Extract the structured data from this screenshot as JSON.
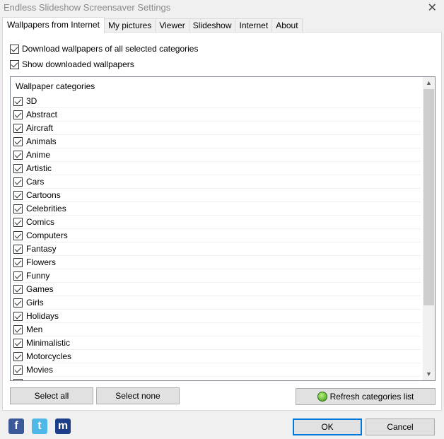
{
  "window": {
    "title": "Endless Slideshow Screensaver Settings",
    "close": "✕"
  },
  "tabs": [
    {
      "label": "Wallpapers from Internet",
      "active": true
    },
    {
      "label": "My pictures"
    },
    {
      "label": "Viewer"
    },
    {
      "label": "Slideshow"
    },
    {
      "label": "Internet"
    },
    {
      "label": "About"
    }
  ],
  "options": {
    "download_all": {
      "label": "Download wallpapers of all selected categories",
      "checked": true
    },
    "show_downloaded": {
      "label": "Show downloaded wallpapers",
      "checked": true
    }
  },
  "categories": {
    "header": "Wallpaper categories",
    "items": [
      "3D",
      "Abstract",
      "Aircraft",
      "Animals",
      "Anime",
      "Artistic",
      "Cars",
      "Cartoons",
      "Celebrities",
      "Comics",
      "Computers",
      "Fantasy",
      "Flowers",
      "Funny",
      "Games",
      "Girls",
      "Holidays",
      "Men",
      "Minimalistic",
      "Motorcycles",
      "Movies"
    ],
    "all_checked": true
  },
  "buttons": {
    "select_all": "Select all",
    "select_none": "Select none",
    "refresh": "Refresh categories list",
    "ok": "OK",
    "cancel": "Cancel"
  },
  "social": [
    {
      "icon": "facebook-icon",
      "glyph": "f",
      "color": "#3b5998"
    },
    {
      "icon": "twitter-icon",
      "glyph": "t",
      "color": "#4fb8e6"
    },
    {
      "icon": "myspace-icon",
      "glyph": "m",
      "color": "#1d3f8a"
    }
  ]
}
